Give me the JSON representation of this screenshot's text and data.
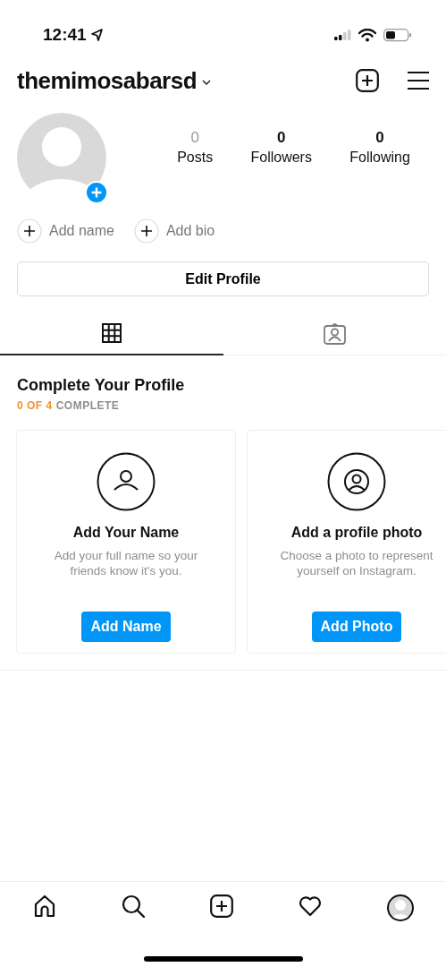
{
  "status_bar": {
    "time": "12:41"
  },
  "header": {
    "username": "themimosabarsd"
  },
  "stats": [
    {
      "count": "0",
      "label": "Posts",
      "muted": true
    },
    {
      "count": "0",
      "label": "Followers",
      "muted": false
    },
    {
      "count": "0",
      "label": "Following",
      "muted": false
    }
  ],
  "quick_actions": [
    "Add name",
    "Add bio"
  ],
  "edit_button": "Edit Profile",
  "tabs": [
    {
      "kind": "grid",
      "selected": true
    },
    {
      "kind": "tagged",
      "selected": false
    }
  ],
  "complete": {
    "title": "Complete Your Profile",
    "progress": "0 OF 4",
    "progress_label": "COMPLETE",
    "cards": [
      {
        "kind": "name",
        "title": "Add Your Name",
        "text": "Add your full name so your friends know it's you.",
        "button": "Add Name"
      },
      {
        "kind": "photo",
        "title": "Add a profile photo",
        "text": "Choose a photo to represent yourself on Instagram.",
        "button": "Add Photo"
      }
    ]
  },
  "bottom_nav": [
    {
      "kind": "home"
    },
    {
      "kind": "search"
    },
    {
      "kind": "new"
    },
    {
      "kind": "activity"
    },
    {
      "kind": "profile"
    }
  ]
}
